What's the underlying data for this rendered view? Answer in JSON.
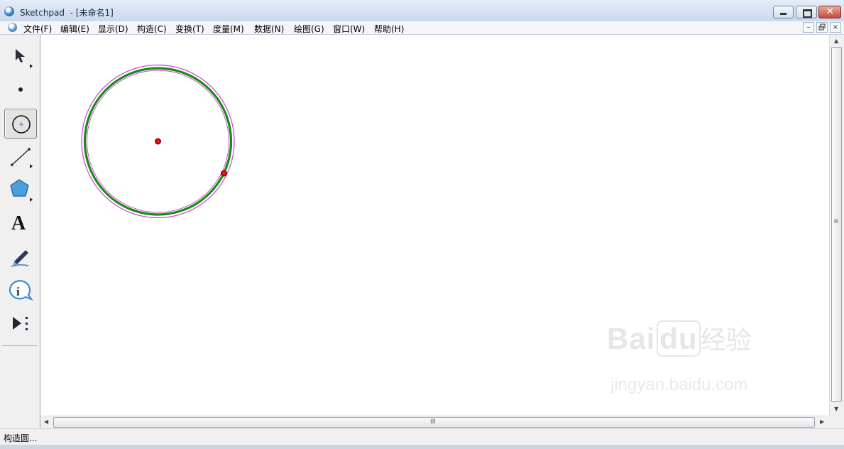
{
  "window": {
    "title": "Sketchpad  - [未命名1]",
    "controls": {
      "minimize_icon": "minimize-icon",
      "maximize_icon": "maximize-icon",
      "close_icon": "close-icon",
      "close_glyph": "✕"
    }
  },
  "menubar": {
    "items": [
      {
        "label": "文件(F)"
      },
      {
        "label": "编辑(E)"
      },
      {
        "label": "显示(D)"
      },
      {
        "label": "构造(C)"
      },
      {
        "label": "变换(T)"
      },
      {
        "label": "度量(M)"
      },
      {
        "label": "数据(N)"
      },
      {
        "label": "绘图(G)"
      },
      {
        "label": "窗口(W)"
      },
      {
        "label": "帮助(H)"
      }
    ],
    "mdi": {
      "minimize": "–",
      "restore": "🗗",
      "close": "×"
    }
  },
  "toolbox": {
    "tools": [
      {
        "name": "selection-arrow-tool",
        "icon": "arrow-icon"
      },
      {
        "name": "point-tool",
        "icon": "point-icon"
      },
      {
        "name": "compass-tool",
        "icon": "circle-icon",
        "selected": true
      },
      {
        "name": "straightedge-tool",
        "icon": "line-icon"
      },
      {
        "name": "polygon-tool",
        "icon": "pentagon-icon"
      },
      {
        "name": "text-tool",
        "icon": "text-a-icon",
        "glyph": "A"
      },
      {
        "name": "marker-tool",
        "icon": "pen-icon"
      },
      {
        "name": "information-tool",
        "icon": "info-icon",
        "glyph": "i"
      },
      {
        "name": "custom-tool",
        "icon": "play-more-icon"
      }
    ]
  },
  "canvas": {
    "circle_color": "#1a8a1a",
    "highlight_color": "#cc44cc",
    "point_color": "#e01010"
  },
  "scroll": {
    "h_grip": "III",
    "v_grip": "≡"
  },
  "watermark": {
    "brand": "Bai",
    "brand2": "du",
    "cn": "经验",
    "url": "jingyan.baidu.com"
  },
  "status": {
    "text": "构造圆..."
  }
}
